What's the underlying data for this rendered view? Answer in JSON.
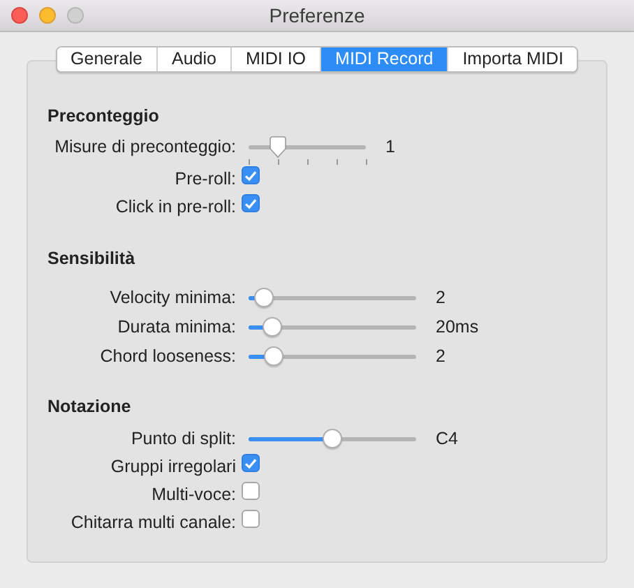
{
  "window": {
    "title": "Preferenze"
  },
  "tabs": [
    {
      "label": "Generale",
      "selected": false
    },
    {
      "label": "Audio",
      "selected": false
    },
    {
      "label": "MIDI IO",
      "selected": false
    },
    {
      "label": "MIDI Record",
      "selected": true
    },
    {
      "label": "Importa MIDI",
      "selected": false
    }
  ],
  "sections": [
    {
      "heading": "Preconteggio",
      "rows": [
        {
          "kind": "tick-slider",
          "label": "Misure di preconteggio:",
          "level": 0.25,
          "value": "1"
        },
        {
          "kind": "checkbox",
          "label": "Pre-roll:",
          "checked": true
        },
        {
          "kind": "checkbox",
          "label": "Click in pre-roll:",
          "checked": true
        }
      ]
    },
    {
      "heading": "Sensibilità",
      "rows": [
        {
          "kind": "slider",
          "label": "Velocity minima:",
          "level": 0.09,
          "value": "2"
        },
        {
          "kind": "slider",
          "label": "Durata minima:",
          "level": 0.14,
          "value": "20ms"
        },
        {
          "kind": "slider",
          "label": "Chord looseness:",
          "level": 0.15,
          "value": "2"
        }
      ]
    },
    {
      "heading": "Notazione",
      "rows": [
        {
          "kind": "slider",
          "label": "Punto di split:",
          "level": 0.5,
          "value": "C4"
        },
        {
          "kind": "checkbox",
          "label": "Gruppi irregolari",
          "checked": true
        },
        {
          "kind": "checkbox",
          "label": "Multi-voce:",
          "checked": false
        },
        {
          "kind": "checkbox",
          "label": "Chitarra multi canale:",
          "checked": false
        }
      ]
    }
  ]
}
